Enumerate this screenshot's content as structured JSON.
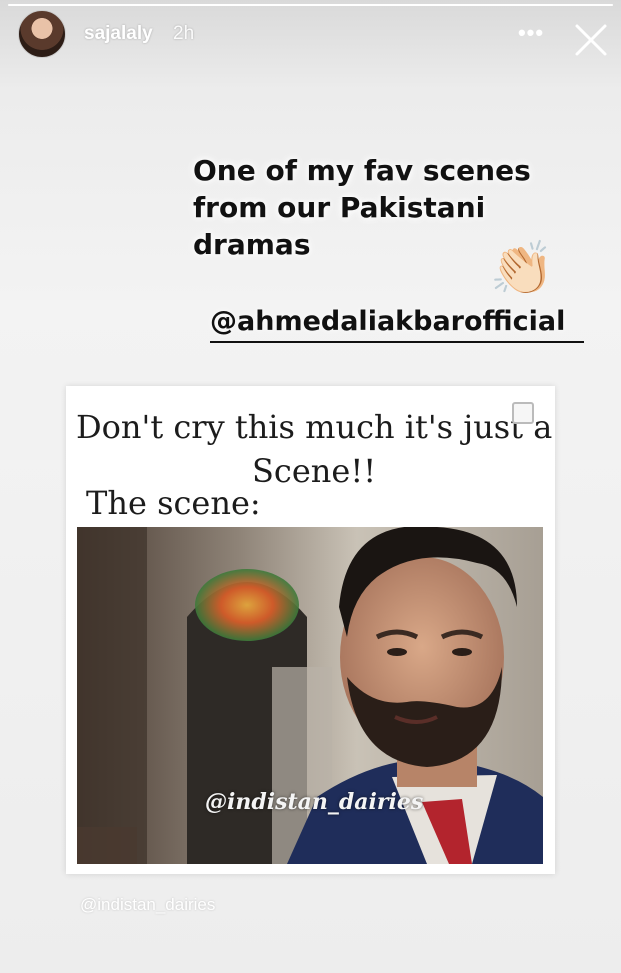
{
  "story": {
    "progress": 1.0,
    "user": {
      "username": "sajalaly",
      "time_ago": "2h"
    },
    "header_icons": {
      "avatar": "profile-avatar",
      "more": "more-horizontal-icon",
      "close": "close-icon"
    },
    "caption": {
      "lines": [
        "One of my fav scenes",
        "from our Pakistani",
        "dramas"
      ],
      "emoji": "👏🏻",
      "mention": "@ahmedaliakbarofficial"
    },
    "meme": {
      "line1": "Don't cry this much it's just a",
      "line2": "Scene!!",
      "line3": "The scene:",
      "inner_watermark": "@indistan_dairies"
    },
    "outer_watermark": "@indistan_dairies"
  },
  "colors": {
    "text": "#111111",
    "header_text": "#ffffff",
    "tie": "#b3242d",
    "suit": "#1f2d5a"
  }
}
